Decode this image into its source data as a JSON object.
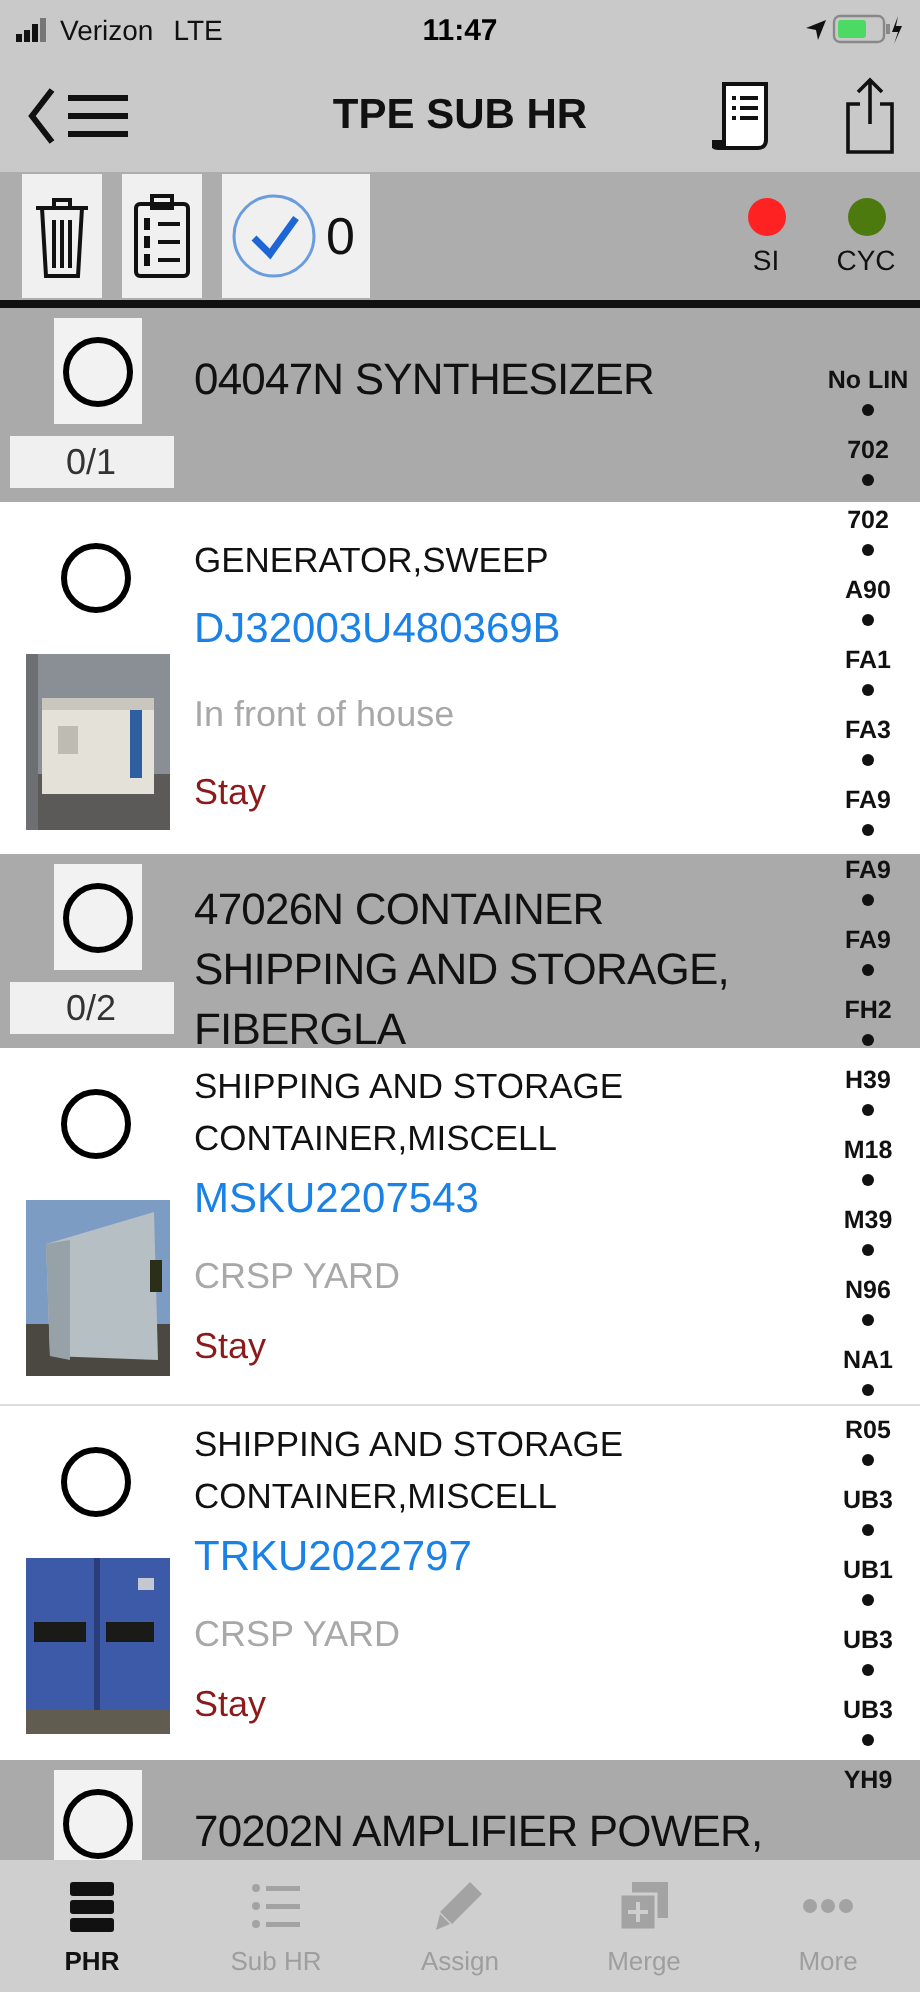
{
  "status_bar": {
    "carrier": "Verizon",
    "network": "LTE",
    "time": "11:47"
  },
  "nav": {
    "title": "TPE SUB HR"
  },
  "toolbar": {
    "selected_count": "0",
    "indicators": [
      {
        "label": "SI",
        "color": "#ff2222"
      },
      {
        "label": "CYC",
        "color": "#4d7a0f"
      }
    ]
  },
  "groups": [
    {
      "title": "04047N SYNTHESIZER",
      "count": "0/1",
      "checked": false,
      "items": [
        {
          "name": "GENERATOR,SWEEP",
          "serial": "DJ32003U480369B",
          "location": "In front of house",
          "status": "Stay",
          "checked": false
        }
      ]
    },
    {
      "title": "47026N CONTAINER SHIPPING AND STORAGE, FIBERGLA",
      "count": "0/2",
      "checked": false,
      "items": [
        {
          "name": "SHIPPING AND STORAGE CONTAINER,MISCELL",
          "serial": "MSKU2207543",
          "location": "CRSP YARD",
          "status": "Stay",
          "checked": false
        },
        {
          "name": "SHIPPING AND STORAGE CONTAINER,MISCELL",
          "serial": "TRKU2022797",
          "location": "CRSP YARD",
          "status": "Stay",
          "checked": false
        }
      ]
    },
    {
      "title": "70202N AMPLIFIER POWER,",
      "checked": false
    }
  ],
  "index": [
    "No LIN",
    "702",
    "702",
    "A90",
    "FA1",
    "FA3",
    "FA9",
    "FA9",
    "FA9",
    "FH2",
    "H39",
    "M18",
    "M39",
    "N96",
    "NA1",
    "R05",
    "UB3",
    "UB1",
    "UB3",
    "UB3",
    "YH9"
  ],
  "tabs": [
    {
      "label": "PHR",
      "selected": true
    },
    {
      "label": "Sub HR",
      "selected": false
    },
    {
      "label": "Assign",
      "selected": false
    },
    {
      "label": "Merge",
      "selected": false
    },
    {
      "label": "More",
      "selected": false
    }
  ]
}
